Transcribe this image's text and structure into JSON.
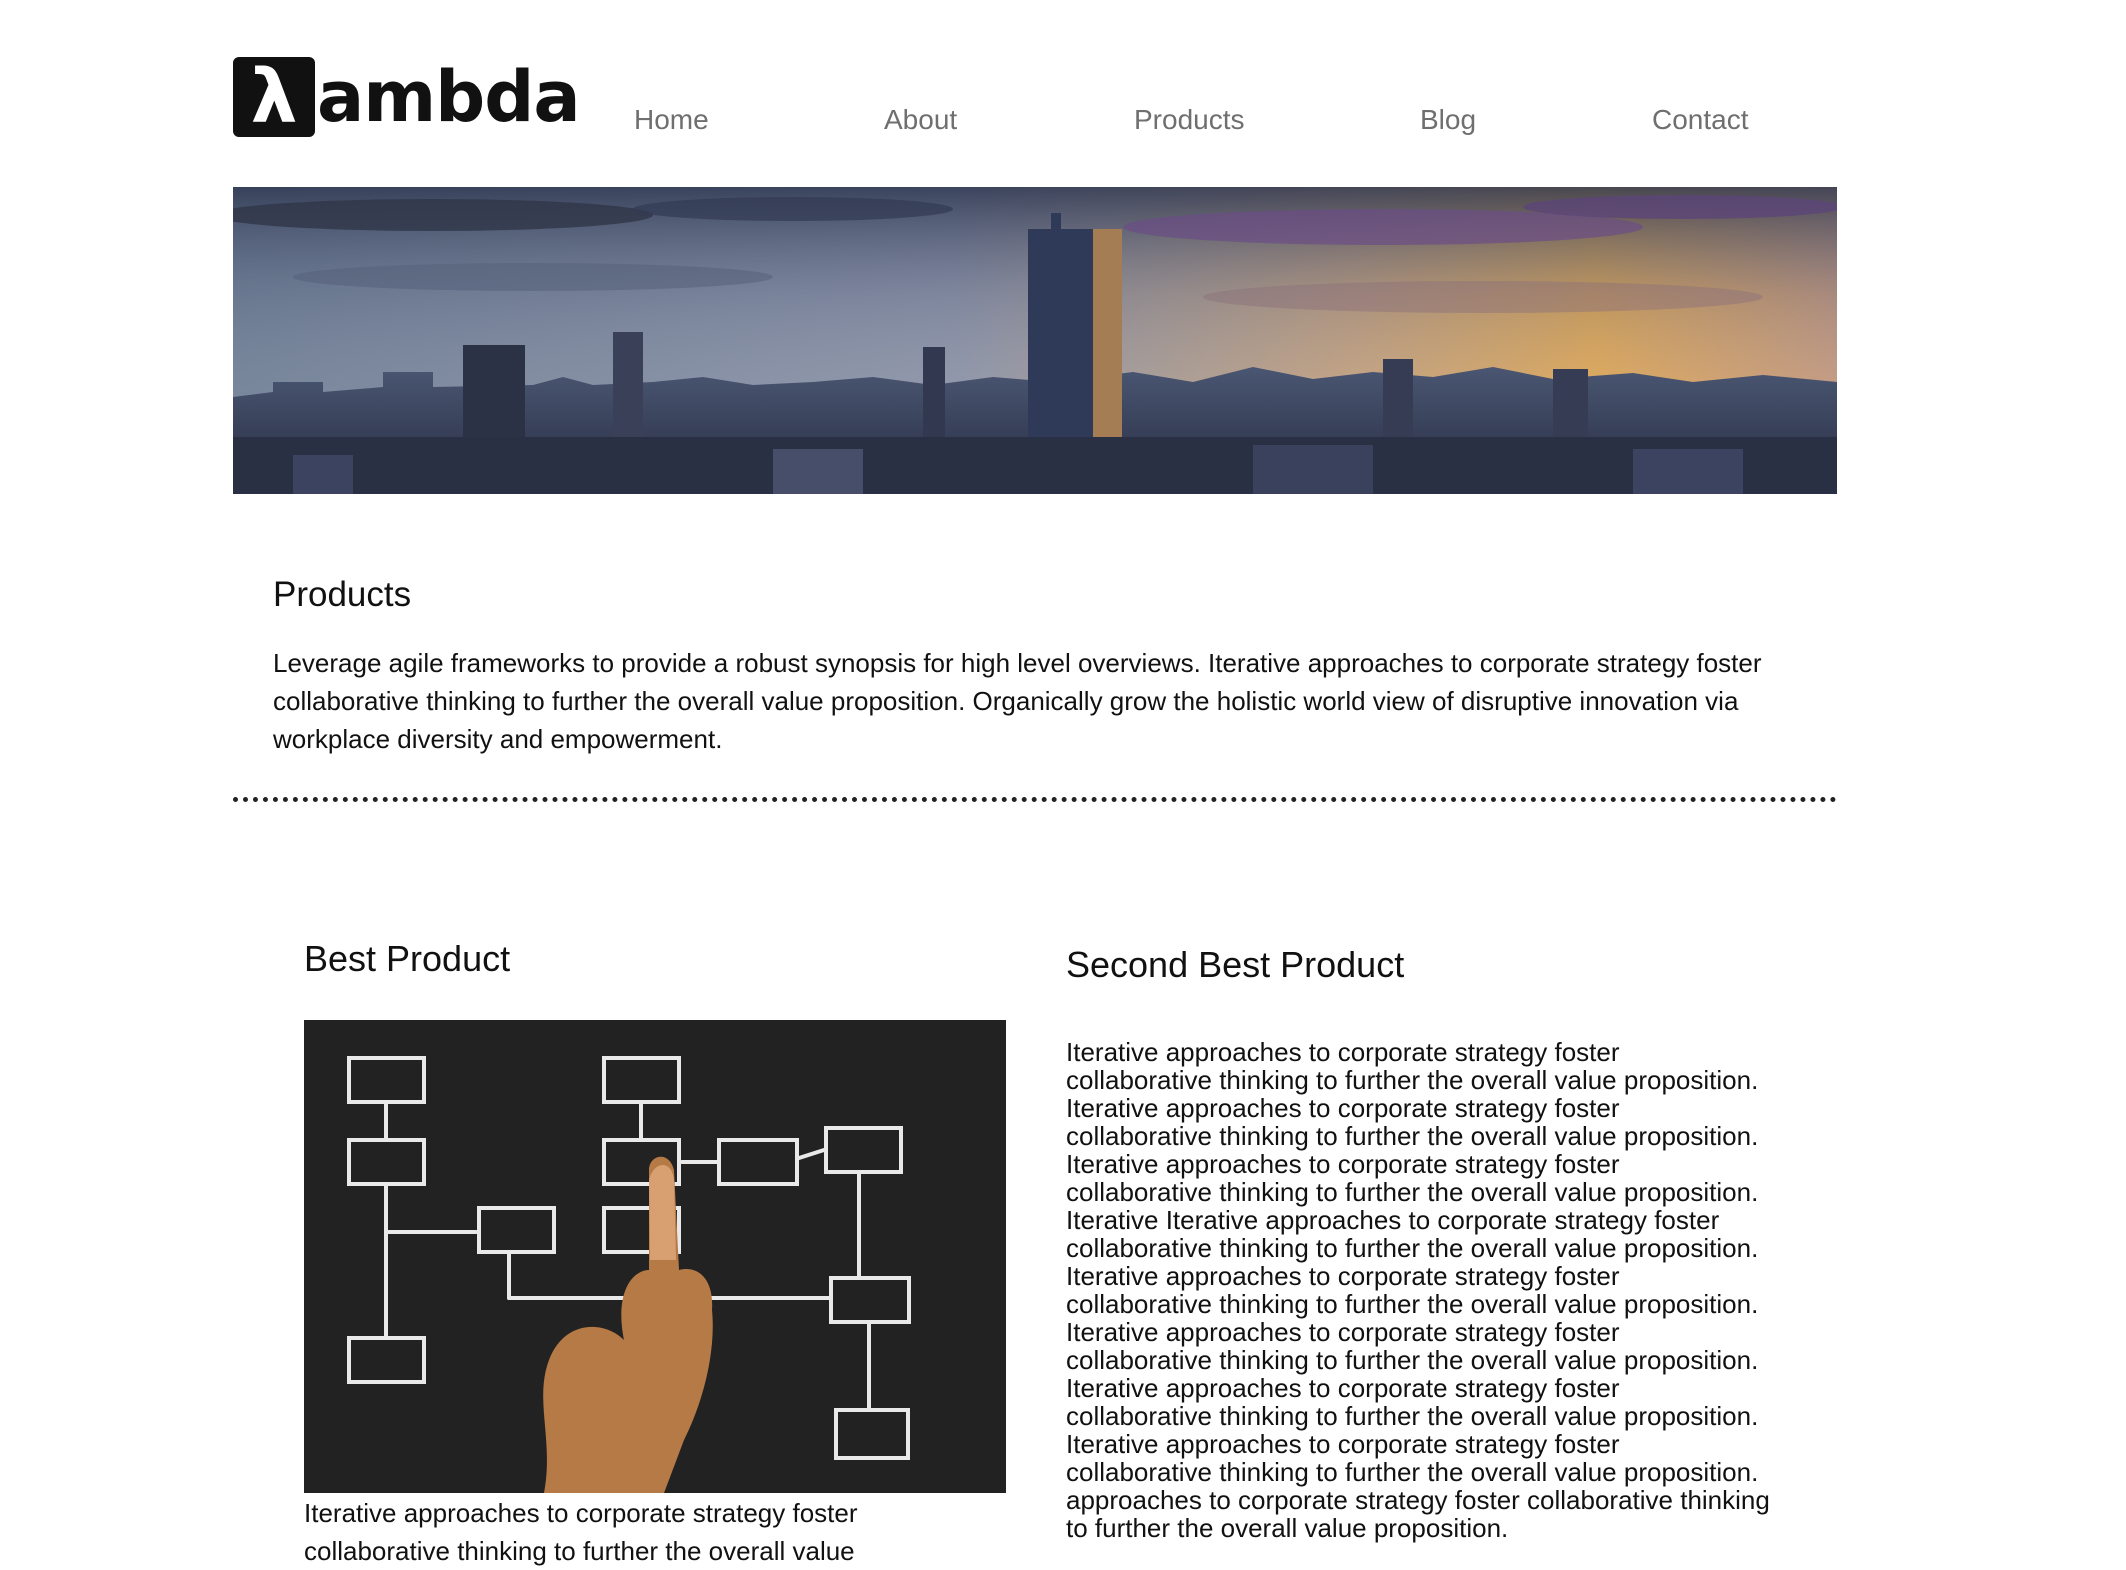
{
  "header": {
    "logo": {
      "symbol": "λ",
      "text": "ambda"
    },
    "nav": {
      "home": "Home",
      "about": "About",
      "products": "Products",
      "blog": "Blog",
      "contact": "Contact"
    }
  },
  "hero": {
    "image": "city-skyline-sunset"
  },
  "intro": {
    "title": "Products",
    "description": "Leverage agile frameworks to provide a robust synopsis for high level overviews. Iterative approaches to corporate strategy foster collaborative thinking to further the overall value proposition. Organically grow the holistic world view of disruptive innovation via workplace diversity and empowerment."
  },
  "best_product": {
    "title": "Best Product",
    "image": "flowchart-hand-pointing",
    "text": "Iterative approaches to corporate strategy foster collaborative thinking to further the overall value"
  },
  "second_best_product": {
    "title": "Second Best Product",
    "text": "Iterative approaches to corporate strategy foster collaborative thinking to further the overall value proposition. Iterative approaches to corporate strategy foster collaborative thinking to further the overall value proposition. Iterative approaches to corporate strategy foster collaborative thinking to further the overall value proposition. Iterative Iterative approaches to corporate strategy foster collaborative thinking to further the overall value proposition. Iterative approaches to corporate strategy foster collaborative thinking to further the overall value proposition. Iterative approaches to corporate strategy foster collaborative thinking to further the overall value proposition. Iterative approaches to corporate strategy foster collaborative thinking to further the overall value proposition. Iterative approaches to corporate strategy foster collaborative thinking to further the overall value proposition. approaches to corporate strategy foster collaborative thinking to further the overall value proposition."
  },
  "colors": {
    "nav_text": "#6f6f6f",
    "text": "#111111",
    "divider": "#222222",
    "image_dark_bg": "#232323"
  }
}
